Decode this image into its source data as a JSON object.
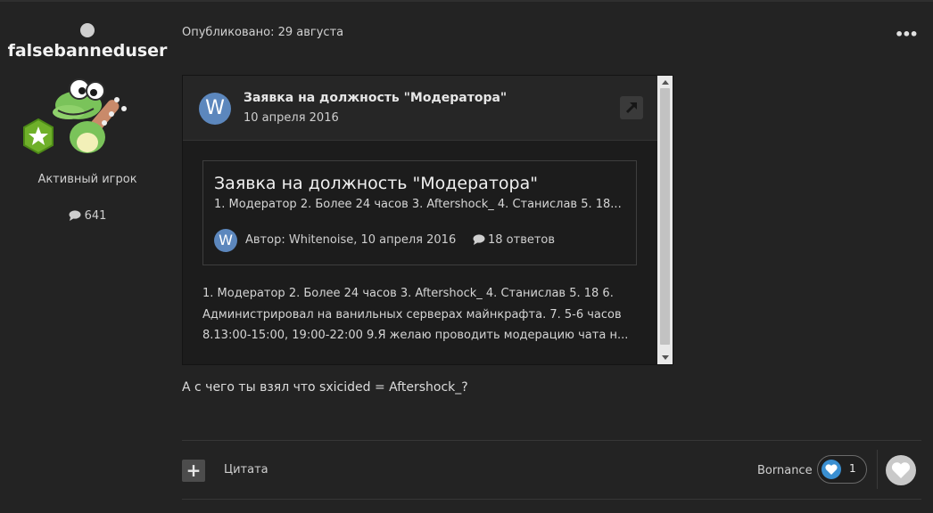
{
  "author": {
    "username": "falsebanneduser",
    "role": "Активный игрок",
    "post_count": "641"
  },
  "post": {
    "date": "Опубликовано: 29 августа",
    "menu": "•••",
    "reply_text": "А с чего ты взял что sxicided = Aftershock_?"
  },
  "embed": {
    "avatar_letter": "W",
    "title": "Заявка на должность \"Модератора\"",
    "date": "10 апреля 2016",
    "card": {
      "title": "Заявка на должность \"Модератора\"",
      "excerpt": "1. Модератор  2. Более 24 часов 3. Aftershock_ 4. Станислав 5. 18...",
      "avatar_letter": "W",
      "author": "Автор: Whitenoise, 10 апреля 2016",
      "replies": "18 ответов"
    },
    "body_lines": [
      "1. Модератор  2. Более 24 часов 3. Aftershock_ 4. Станислав 5. 18 6.",
      "Администрировал на ванильных серверах майнкрафта. 7. 5-6 часов",
      "8.13:00-15:00, 19:00-22:00 9.Я желаю проводить модерацию чата н..."
    ]
  },
  "footer": {
    "plus_label": "+",
    "quote_label": "Цитата",
    "reactor_name": "Bornance",
    "reaction_count": "1"
  },
  "colors": {
    "background": "#232323",
    "embed_background": "#1c1c1c",
    "avatar_blue": "#5c87bd",
    "reaction_blue": "#3a8fd1",
    "badge_green": "#6fb02a"
  },
  "icons": [
    "online-status-icon",
    "rank-star-icon",
    "comment-icon",
    "external-link-icon",
    "heart-icon",
    "like-icon"
  ]
}
